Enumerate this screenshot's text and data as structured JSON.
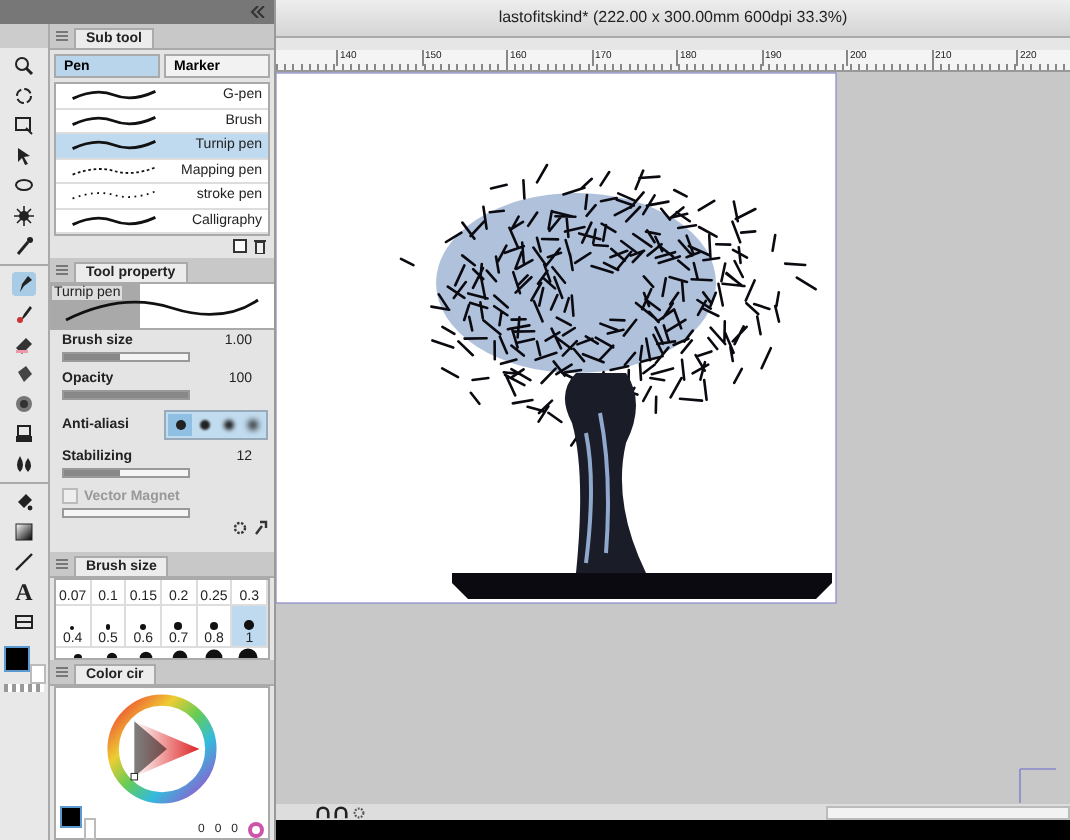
{
  "canvas_window": {
    "title": "lastofitskind* (222.00 x 300.00mm 600dpi 33.3%)",
    "ruler_labels": [
      "140",
      "150",
      "160",
      "170",
      "180",
      "190",
      "200",
      "210",
      "220"
    ]
  },
  "toolbar": {
    "text_tool_glyph": "A"
  },
  "sub_tool": {
    "title": "Sub tool",
    "tabs": [
      {
        "label": "Pen",
        "selected": true
      },
      {
        "label": "Marker",
        "selected": false
      }
    ],
    "items": [
      {
        "label": "G-pen",
        "selected": false
      },
      {
        "label": "Brush",
        "selected": false
      },
      {
        "label": "Turnip pen",
        "selected": true
      },
      {
        "label": "Mapping pen",
        "selected": false
      },
      {
        "label": "stroke pen",
        "selected": false
      },
      {
        "label": "Calligraphy",
        "selected": false
      }
    ]
  },
  "tool_property": {
    "title": "Tool property",
    "preview_label": "Turnip pen",
    "settings": [
      {
        "kind": "slider",
        "label": "Brush size",
        "value": "1.00",
        "level": 0.45
      },
      {
        "kind": "slider",
        "label": "Opacity",
        "value": "100",
        "level": 1
      },
      {
        "kind": "antialias",
        "label": "Anti-aliasi",
        "options": [
          {
            "selected": true
          },
          {
            "selected": false
          },
          {
            "selected": false
          },
          {
            "selected": false
          }
        ]
      },
      {
        "kind": "slider",
        "label": "Stabilizing",
        "value": "12",
        "level": 0.45
      },
      {
        "kind": "checkbox",
        "label": "Vector Magnet",
        "checked": false,
        "disabled": true
      }
    ]
  },
  "brush_size": {
    "title": "Brush size",
    "sizes": [
      {
        "label": "0.07",
        "selected": false
      },
      {
        "label": "0.1",
        "selected": false
      },
      {
        "label": "0.15",
        "selected": false
      },
      {
        "label": "0.2",
        "selected": false
      },
      {
        "label": "0.25",
        "selected": false
      },
      {
        "label": "0.3",
        "selected": false
      },
      {
        "label": "0.4",
        "selected": false
      },
      {
        "label": "0.5",
        "selected": false
      },
      {
        "label": "0.6",
        "selected": false
      },
      {
        "label": "0.7",
        "selected": false
      },
      {
        "label": "0.8",
        "selected": false
      },
      {
        "label": "1",
        "selected": true
      }
    ]
  },
  "color_circle": {
    "title": "Color cir",
    "readouts": [
      "0",
      "0",
      "0"
    ]
  }
}
